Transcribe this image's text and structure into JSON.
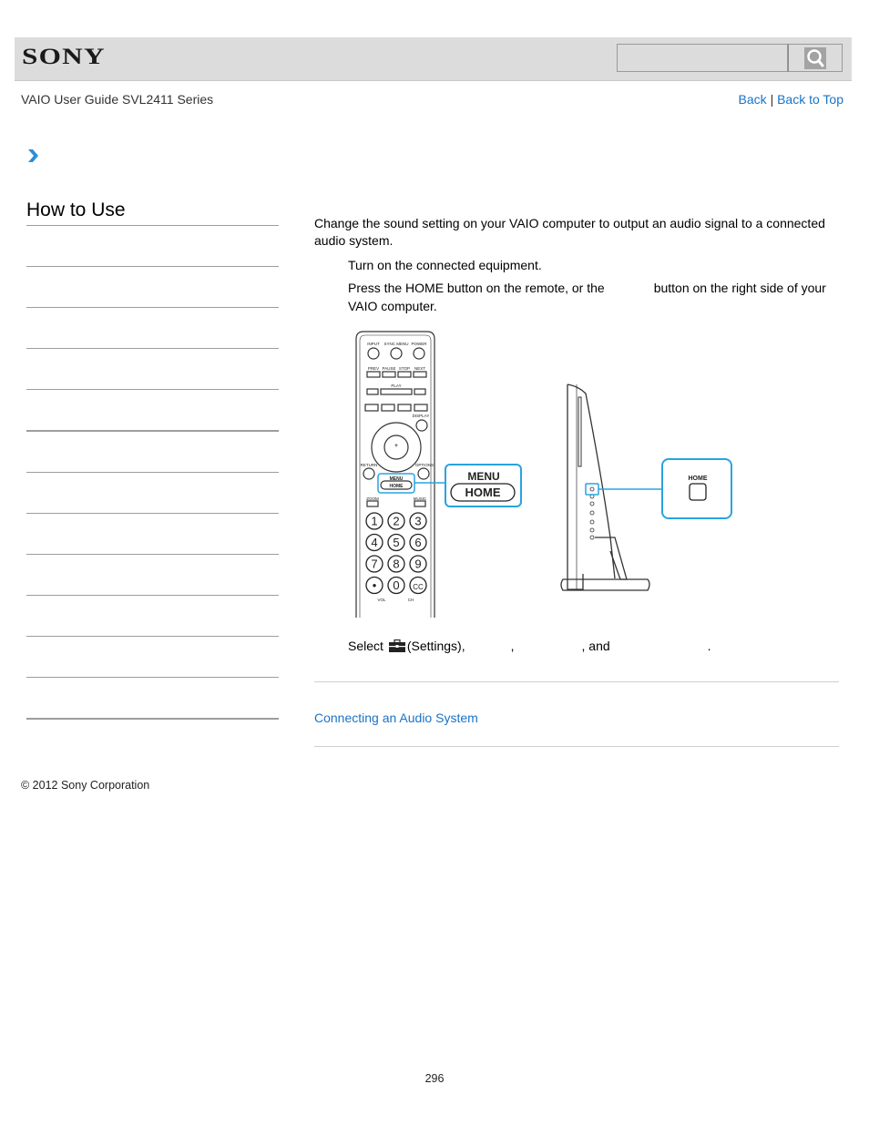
{
  "header": {
    "logo_text": "SONY",
    "search": {
      "value": "",
      "placeholder": ""
    },
    "search_button_icon": "magnifier-icon"
  },
  "subheader": {
    "guide_title": "VAIO User Guide SVL2411 Series",
    "back_label": "Back",
    "separator": "|",
    "back_to_top_label": "Back to Top"
  },
  "breadcrumb": {
    "icon": "chevron-right-icon"
  },
  "sidebar": {
    "title": "How to Use",
    "items": [
      {
        "label": ""
      },
      {
        "label": ""
      },
      {
        "label": ""
      },
      {
        "label": ""
      },
      {
        "label": ""
      },
      {
        "label": ""
      },
      {
        "label": ""
      },
      {
        "label": ""
      },
      {
        "label": ""
      },
      {
        "label": ""
      },
      {
        "label": ""
      },
      {
        "label": ""
      }
    ]
  },
  "main": {
    "intro": "Change the sound setting on your VAIO computer to output an audio signal to a connected audio system.",
    "steps": [
      {
        "text": "Turn on the connected equipment."
      },
      {
        "text_before": "Press the HOME button on the remote, or the",
        "text_after": "button on the right side of your VAIO computer."
      },
      {
        "select_label": "Select",
        "settings_label": "(Settings),",
        "comma1": ",",
        "comma2": ", and",
        "period": "."
      }
    ],
    "illustration": {
      "remote_labels": {
        "input": "INPUT",
        "sync_menu": "SYNC MENU",
        "power": "POWER",
        "prev": "PREV",
        "pause": "PAUSE",
        "stop": "STOP",
        "next": "NEXT",
        "play": "PLAY",
        "display": "DISPLAY",
        "return": "RETURN",
        "options": "OPTIONS",
        "menu": "MENU",
        "home": "HOME",
        "zoom": "ZOOM",
        "music": "MUSIC",
        "vol": "VOL",
        "ch": "CH"
      },
      "keypad": [
        "1",
        "2",
        "3",
        "4",
        "5",
        "6",
        "7",
        "8",
        "9",
        "•",
        "0",
        "CC"
      ],
      "callout_menu": "MENU",
      "callout_home": "HOME",
      "pc_callout_home": "HOME",
      "highlight_color": "#29a3e0"
    },
    "related_link": "Connecting an Audio System"
  },
  "footer": {
    "copyright": "© 2012 Sony Corporation",
    "page_number": "296"
  },
  "colors": {
    "link": "#1a73c7",
    "header_bg": "#dcdcdc",
    "accent_chevron": "#2b8fd6"
  }
}
